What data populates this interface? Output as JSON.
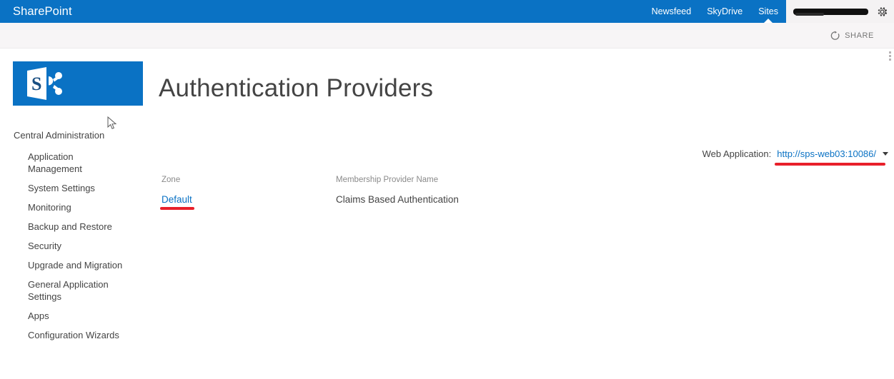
{
  "suite_bar": {
    "brand": "SharePoint",
    "links": [
      {
        "label": "Newsfeed",
        "selected": false
      },
      {
        "label": "SkyDrive",
        "selected": false
      },
      {
        "label": "Sites",
        "selected": true
      }
    ],
    "user_name_redacted": "",
    "settings_icon": "gear-icon",
    "background_color": "#0a72c4"
  },
  "command_bar": {
    "share_label": "SHARE",
    "share_icon": "share-circle-icon"
  },
  "branding": {
    "logo_icon": "sharepoint-logo-icon",
    "logo_color": "#0a72c4"
  },
  "left_nav": {
    "heading": "Central Administration",
    "items": [
      {
        "label": "Application Management"
      },
      {
        "label": "System Settings"
      },
      {
        "label": "Monitoring"
      },
      {
        "label": "Backup and Restore"
      },
      {
        "label": "Security"
      },
      {
        "label": "Upgrade and Migration"
      },
      {
        "label": "General Application Settings"
      },
      {
        "label": "Apps"
      },
      {
        "label": "Configuration Wizards"
      }
    ]
  },
  "page": {
    "title": "Authentication Providers"
  },
  "web_application": {
    "label": "Web Application:",
    "value": "http://sps-web03:10086/",
    "caret_icon": "chevron-down-icon",
    "link_color": "#0a72c4"
  },
  "zone_table": {
    "columns": [
      "Zone",
      "Membership Provider Name"
    ],
    "rows": [
      {
        "zone": "Default",
        "provider": "Claims Based Authentication"
      }
    ]
  },
  "annotations": {
    "color": "#e8202a",
    "underlines": [
      "web-application-value",
      "zone-default-link"
    ]
  }
}
